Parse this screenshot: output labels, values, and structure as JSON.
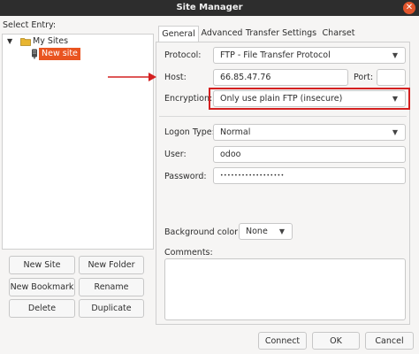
{
  "window": {
    "title": "Site Manager"
  },
  "left": {
    "select_entry_label": "Select Entry:",
    "tree": {
      "folder_label": "My Sites",
      "site_label": "New site"
    },
    "buttons": {
      "new_site": "New Site",
      "new_folder": "New Folder",
      "new_bookmark": "New Bookmark",
      "rename": "Rename",
      "delete": "Delete",
      "duplicate": "Duplicate"
    }
  },
  "tabs": [
    "General",
    "Advanced",
    "Transfer Settings",
    "Charset"
  ],
  "general": {
    "protocol_label": "Protocol:",
    "protocol_value": "FTP - File Transfer Protocol",
    "host_label": "Host:",
    "host_value": "66.85.47.76",
    "port_label": "Port:",
    "port_value": "",
    "encryption_label": "Encryption:",
    "encryption_value": "Only use plain FTP (insecure)",
    "logon_type_label": "Logon Type:",
    "logon_type_value": "Normal",
    "user_label": "User:",
    "user_value": "odoo",
    "password_label": "Password:",
    "password_value": "••••••••••••••••••",
    "bg_color_label": "Background color:",
    "bg_color_value": "None",
    "comments_label": "Comments:",
    "comments_value": ""
  },
  "footer": {
    "connect": "Connect",
    "ok": "OK",
    "cancel": "Cancel"
  },
  "annotation_color": "#d42020"
}
